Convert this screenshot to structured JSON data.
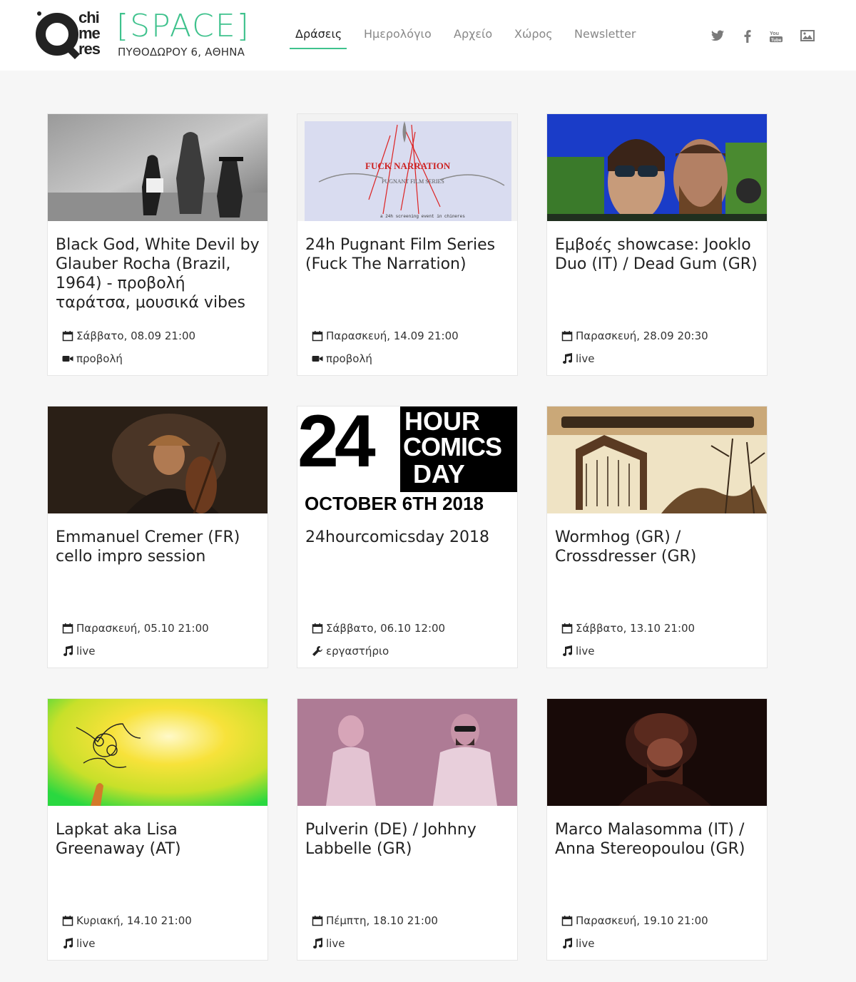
{
  "header": {
    "logo_word": [
      "chi",
      "me",
      "res"
    ],
    "logo_space": "[SPACE]",
    "logo_address": "ΠΥΘΟΔΩΡΟΥ 6, ΑΘΗΝΑ",
    "nav": [
      {
        "label": "Δράσεις",
        "active": true
      },
      {
        "label": "Ημερολόγιο",
        "active": false
      },
      {
        "label": "Αρχείο",
        "active": false
      },
      {
        "label": "Χώρος",
        "active": false
      },
      {
        "label": "Newsletter",
        "active": false
      }
    ],
    "social": [
      "twitter-icon",
      "facebook-icon",
      "youtube-icon",
      "gallery-icon"
    ],
    "accent_color": "#3fc28d"
  },
  "events": [
    {
      "title": "Black God, White Devil by Glauber Rocha (Brazil, 1964) - προβολή ταράτσα, μουσικά vibes",
      "date": "Σάββατο, 08.09 21:00",
      "type": "προβολή",
      "type_icon": "video-camera-icon"
    },
    {
      "title": "24h Pugnant Film Series (Fuck The Narration)",
      "date": "Παρασκευή, 14.09 21:00",
      "type": "προβολή",
      "type_icon": "video-camera-icon",
      "image_text": {
        "headline": "FUCK NARRATION",
        "sub": "PUGNANT FILM SERIES",
        "foot": "a 24h screening event in chineres"
      }
    },
    {
      "title": "Εμβοές showcase: Jooklo Duo (IT) / Dead Gum (GR)",
      "date": "Παρασκευή, 28.09 20:30",
      "type": "live",
      "type_icon": "music-note-icon"
    },
    {
      "title": "Emmanuel Cremer (FR) cello impro session",
      "date": "Παρασκευή, 05.10 21:00",
      "type": "live",
      "type_icon": "music-note-icon"
    },
    {
      "title": "24hourcomicsday 2018",
      "date": "Σάββατο, 06.10 12:00",
      "type": "εργαστήριο",
      "type_icon": "wrench-icon",
      "image_text": {
        "big": "24",
        "l1": "HOUR",
        "l2": "COMICS",
        "l3": "DAY",
        "bottom": "OCTOBER 6TH 2018"
      }
    },
    {
      "title": "Wormhog (GR) / Crossdresser (GR)",
      "date": "Σάββατο, 13.10 21:00",
      "type": "live",
      "type_icon": "music-note-icon"
    },
    {
      "title": "Lapkat aka Lisa Greenaway (AT)",
      "date": "Κυριακή, 14.10 21:00",
      "type": "live",
      "type_icon": "music-note-icon"
    },
    {
      "title": "Pulverin (DE) / Johhny Labbelle (GR)",
      "date": "Πέμπτη, 18.10 21:00",
      "type": "live",
      "type_icon": "music-note-icon"
    },
    {
      "title": "Marco Malasomma (IT) / Anna Stereopoulou (GR)",
      "date": "Παρασκευή, 19.10 21:00",
      "type": "live",
      "type_icon": "music-note-icon"
    }
  ]
}
